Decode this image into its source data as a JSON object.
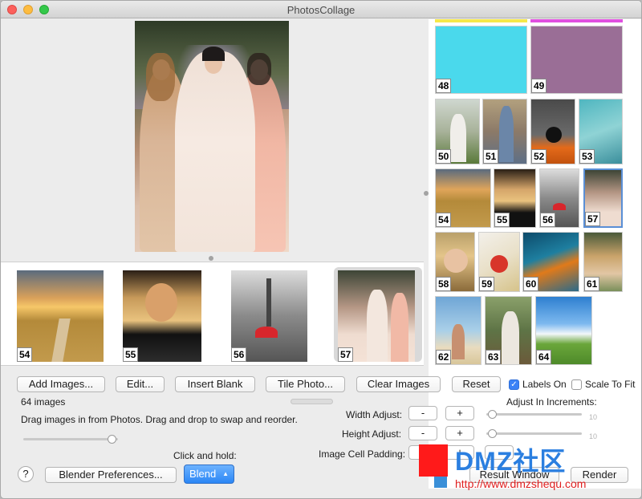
{
  "window": {
    "title": "PhotosCollage"
  },
  "strip": {
    "items": [
      {
        "num": "54"
      },
      {
        "num": "55"
      },
      {
        "num": "56"
      },
      {
        "num": "57"
      }
    ]
  },
  "grid": {
    "items": [
      {
        "num": "48"
      },
      {
        "num": "49"
      },
      {
        "num": "50"
      },
      {
        "num": "51"
      },
      {
        "num": "52"
      },
      {
        "num": "53"
      },
      {
        "num": "54"
      },
      {
        "num": "55"
      },
      {
        "num": "56"
      },
      {
        "num": "57"
      },
      {
        "num": "58"
      },
      {
        "num": "59"
      },
      {
        "num": "60"
      },
      {
        "num": "61"
      },
      {
        "num": "62"
      },
      {
        "num": "63"
      },
      {
        "num": "64"
      }
    ]
  },
  "buttons": {
    "add_images": "Add Images...",
    "edit": "Edit...",
    "insert_blank": "Insert Blank",
    "tile_photo": "Tile Photo...",
    "clear_images": "Clear Images",
    "reset": "Reset",
    "blender_prefs": "Blender Preferences...",
    "blend": "Blend",
    "result_window": "Result Window",
    "render": "Render",
    "minus": "-",
    "plus": "+",
    "help": "?"
  },
  "options": {
    "labels_on": "Labels On",
    "labels_on_checked": true,
    "scale_to_fit": "Scale To Fit",
    "scale_to_fit_checked": false
  },
  "info": {
    "count": "64 images",
    "hint": "Drag images in from Photos. Drag and drop to swap and reorder.",
    "click_hold": "Click and hold:",
    "adjust_increments": "Adjust In Increments:"
  },
  "adjust": {
    "width_label": "Width Adjust:",
    "height_label": "Height Adjust:",
    "padding_label": "Image Cell Padding:",
    "width_max": "10",
    "height_max": "10",
    "width_value": 0.02,
    "height_value": 0.02,
    "zoom_value": 0.98
  },
  "watermark": {
    "brand": "DMZ社区",
    "url": "http://www.dmzshequ.com"
  },
  "colors": {
    "tile48": "#4ad9ec",
    "tile49": "#9a6e96",
    "accent": "#2b86f5",
    "selection": "#5a8fd6"
  }
}
